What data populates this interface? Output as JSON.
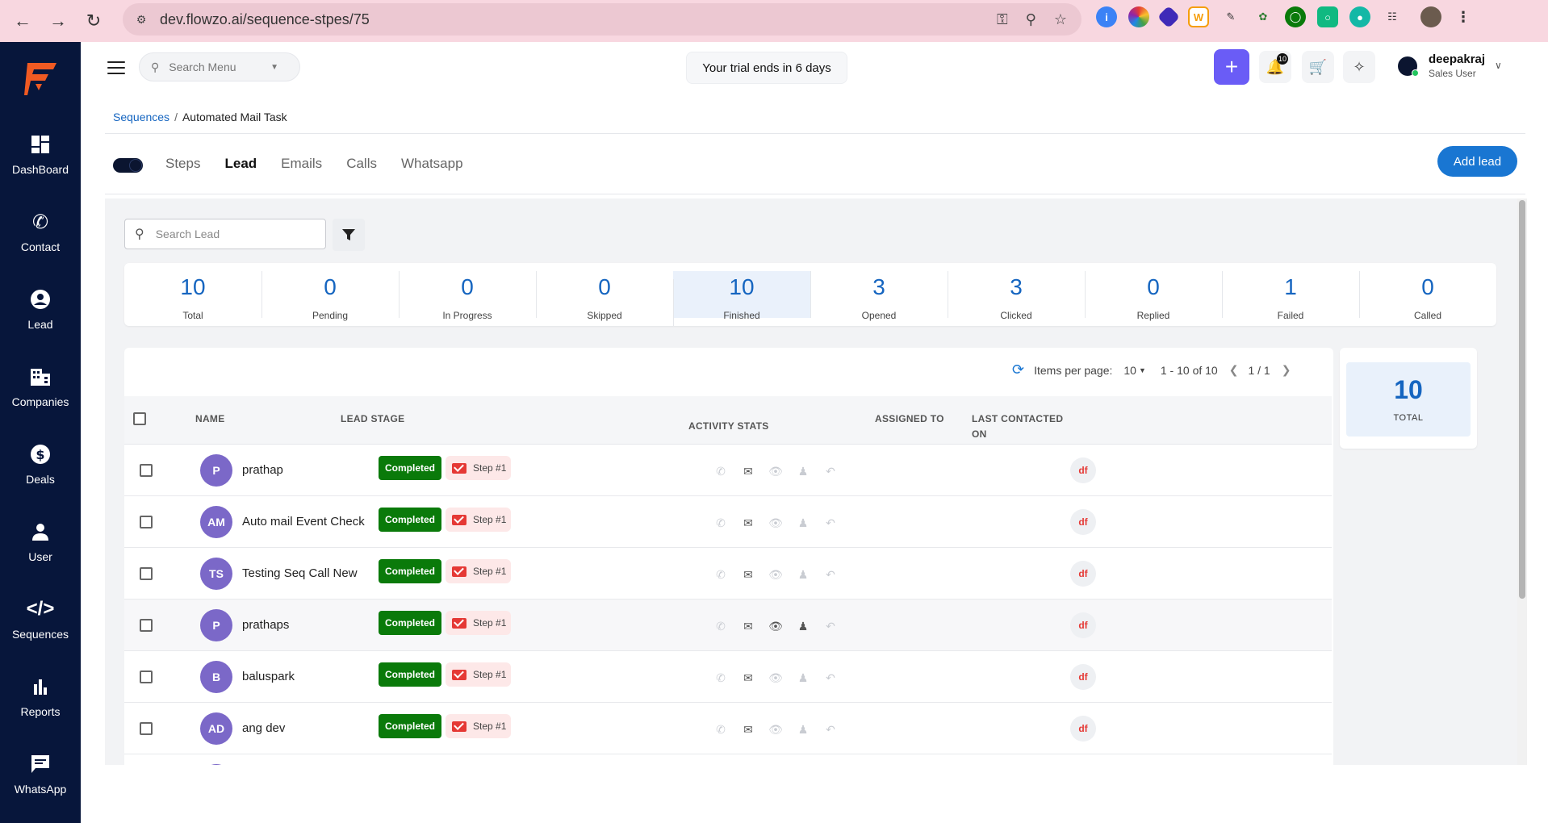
{
  "browser": {
    "url": "dev.flowzo.ai/sequence-stpes/75",
    "back_icon": "arrow-left-icon",
    "forward_icon": "arrow-right-icon",
    "reload_icon": "reload-icon"
  },
  "sidebar": {
    "items": [
      {
        "label": "DashBoard",
        "icon": "dashboard-icon"
      },
      {
        "label": "Contact",
        "icon": "phone-icon"
      },
      {
        "label": "Lead",
        "icon": "user-circle-icon"
      },
      {
        "label": "Companies",
        "icon": "building-icon"
      },
      {
        "label": "Deals",
        "icon": "dollar-icon"
      },
      {
        "label": "User",
        "icon": "user-icon"
      },
      {
        "label": "Sequences",
        "icon": "code-icon"
      },
      {
        "label": "Reports",
        "icon": "bar-chart-icon"
      },
      {
        "label": "WhatsApp",
        "icon": "chat-icon"
      }
    ]
  },
  "header": {
    "search_placeholder": "Search Menu",
    "trial_text": "Your trial ends in 6 days",
    "notification_count": "10",
    "user_name": "deepakraj",
    "user_role": "Sales User"
  },
  "breadcrumb": {
    "parent": "Sequences",
    "separator": "/",
    "current": "Automated Mail Task"
  },
  "tabs": [
    {
      "label": "Steps",
      "active": false
    },
    {
      "label": "Lead",
      "active": true
    },
    {
      "label": "Emails",
      "active": false
    },
    {
      "label": "Calls",
      "active": false
    },
    {
      "label": "Whatsapp",
      "active": false
    }
  ],
  "add_lead_label": "Add lead",
  "lead_search_placeholder": "Search Lead",
  "stats": [
    {
      "value": "10",
      "label": "Total"
    },
    {
      "value": "0",
      "label": "Pending"
    },
    {
      "value": "0",
      "label": "In Progress"
    },
    {
      "value": "0",
      "label": "Skipped"
    },
    {
      "value": "10",
      "label": "Finished"
    },
    {
      "value": "3",
      "label": "Opened"
    },
    {
      "value": "3",
      "label": "Clicked"
    },
    {
      "value": "0",
      "label": "Replied"
    },
    {
      "value": "1",
      "label": "Failed"
    },
    {
      "value": "0",
      "label": "Called"
    }
  ],
  "pager": {
    "items_per_page_label": "Items per page:",
    "items_per_page": "10",
    "range": "1 - 10 of 10",
    "page": "1 / 1"
  },
  "table": {
    "columns": {
      "name": "NAME",
      "lead_stage": "LEAD STAGE",
      "activity_stats": "ACTIVITY STATS",
      "assigned_to": "ASSIGNED TO",
      "last_contacted_1": "LAST CONTACTED",
      "last_contacted_2": "ON"
    },
    "rows": [
      {
        "initials": "P",
        "name": "prathap",
        "stage": "Completed",
        "step": "Step #1",
        "assigned": "df",
        "opened": false,
        "clicked": false
      },
      {
        "initials": "AM",
        "name": "Auto mail Event Check",
        "stage": "Completed",
        "step": "Step #1",
        "assigned": "df",
        "opened": false,
        "clicked": false
      },
      {
        "initials": "TS",
        "name": "Testing Seq Call New",
        "stage": "Completed",
        "step": "Step #1",
        "assigned": "df",
        "opened": false,
        "clicked": false
      },
      {
        "initials": "P",
        "name": "prathaps",
        "stage": "Completed",
        "step": "Step #1",
        "assigned": "df",
        "opened": true,
        "clicked": true
      },
      {
        "initials": "B",
        "name": "baluspark",
        "stage": "Completed",
        "step": "Step #1",
        "assigned": "df",
        "opened": false,
        "clicked": false
      },
      {
        "initials": "AD",
        "name": "ang dev",
        "stage": "Completed",
        "step": "Step #1",
        "assigned": "df",
        "opened": false,
        "clicked": false
      }
    ]
  },
  "total_card": {
    "value": "10",
    "label": "TOTAL"
  },
  "colors": {
    "sidebar_bg": "#07163b",
    "accent_blue": "#1976d2",
    "completed_green": "#0a7a0a",
    "plus_purple": "#6a5cf6"
  }
}
